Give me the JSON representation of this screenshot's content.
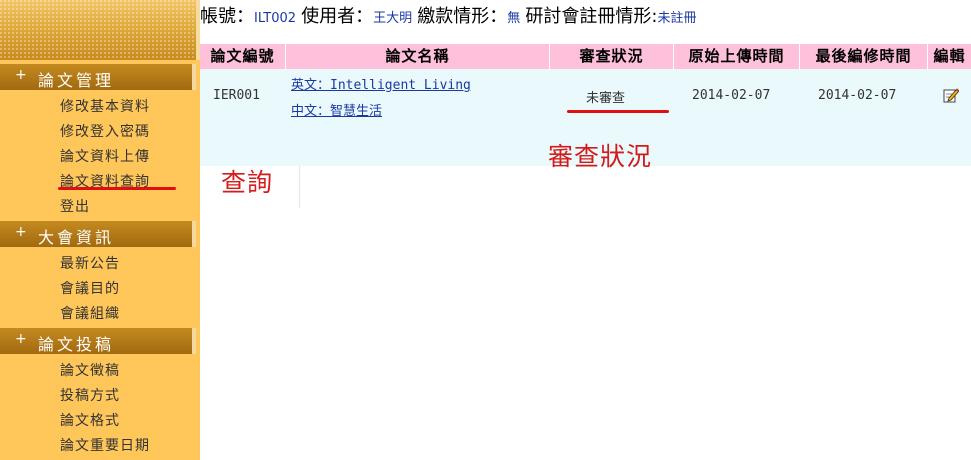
{
  "header": {
    "account_label": "帳號：",
    "account_value": "ILT002",
    "user_label": "使用者：",
    "user_value": "王大明",
    "payment_label": "繳款情形：",
    "payment_value": "無",
    "registration_label": "研討會註冊情形:",
    "registration_value": "未註冊"
  },
  "sidebar": {
    "sections": [
      {
        "title": "論文管理",
        "items": [
          "修改基本資料",
          "修改登入密碼",
          "論文資料上傳",
          "論文資料查詢",
          "登出"
        ]
      },
      {
        "title": "大會資訊",
        "items": [
          "最新公告",
          "會議目的",
          "會議組織"
        ]
      },
      {
        "title": "論文投稿",
        "items": [
          "論文徵稿",
          "投稿方式",
          "論文格式",
          "論文重要日期"
        ]
      }
    ]
  },
  "table": {
    "headers": [
      "論文編號",
      "論文名稱",
      "審查狀況",
      "原始上傳時間",
      "最後編修時間",
      "編輯"
    ],
    "rows": [
      {
        "id": "IER001",
        "title_en": "英文：Intelligent Living",
        "title_zh": "中文：智慧生活",
        "status": "未審查",
        "uploaded": "2014-02-07",
        "modified": "2014-02-07"
      }
    ]
  },
  "annotations": {
    "query_note": "查詢",
    "status_note": "審查狀況"
  },
  "colors": {
    "sidebar_bg": "#ffc65a",
    "section_header": "#b27816",
    "table_header": "#ffc0dc",
    "row_bg": "#eafafc",
    "link": "#1a37a6",
    "annotation_red": "#d41a1a"
  },
  "icons": {
    "edit": "pencil-edit-icon"
  }
}
